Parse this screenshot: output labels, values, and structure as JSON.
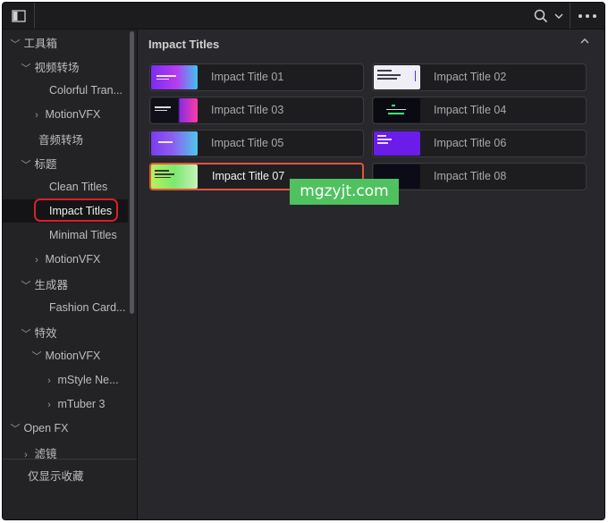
{
  "topbar": {
    "icons": [
      "panel-toggle-icon",
      "search-icon",
      "chevron-down-icon",
      "more-icon"
    ]
  },
  "sidebar": {
    "items": [
      {
        "label": "工具箱",
        "level": 0,
        "expanded": true
      },
      {
        "label": "视频转场",
        "level": 1,
        "expanded": true
      },
      {
        "label": "Colorful Tran...",
        "level": 2
      },
      {
        "label": "MotionVFX",
        "level": 2,
        "collapsed": true
      },
      {
        "label": "音频转场",
        "level": 1
      },
      {
        "label": "标题",
        "level": 1,
        "expanded": true
      },
      {
        "label": "Clean Titles",
        "level": 2
      },
      {
        "label": "Impact Titles",
        "level": 2,
        "selected": true
      },
      {
        "label": "Minimal Titles",
        "level": 2
      },
      {
        "label": "MotionVFX",
        "level": 2,
        "collapsed": true
      },
      {
        "label": "生成器",
        "level": 1,
        "expanded": true
      },
      {
        "label": "Fashion Card...",
        "level": 2
      },
      {
        "label": "特效",
        "level": 1,
        "expanded": true
      },
      {
        "label": "MotionVFX",
        "level": 2,
        "expanded": true
      },
      {
        "label": "mStyle Ne...",
        "level": 3,
        "collapsed": true
      },
      {
        "label": "mTuber 3",
        "level": 3,
        "collapsed": true
      },
      {
        "label": "Open FX",
        "level": 0,
        "expanded": true
      },
      {
        "label": "滤镜",
        "level": 1,
        "collapsed": true
      }
    ],
    "favorites_only": "仅显示收藏"
  },
  "main": {
    "section_title": "Impact Titles",
    "titles": [
      {
        "label": "Impact Title 01"
      },
      {
        "label": "Impact Title 02"
      },
      {
        "label": "Impact Title 03"
      },
      {
        "label": "Impact Title 04"
      },
      {
        "label": "Impact Title 05"
      },
      {
        "label": "Impact Title 06"
      },
      {
        "label": "Impact Title 07",
        "selected": true
      },
      {
        "label": "Impact Title 08"
      }
    ]
  },
  "watermark": "mgzyjt.com",
  "colors": {
    "selection_ring": "#d8202a",
    "active_card_border": "#e0563c",
    "watermark_bg": "#4fc15f"
  }
}
